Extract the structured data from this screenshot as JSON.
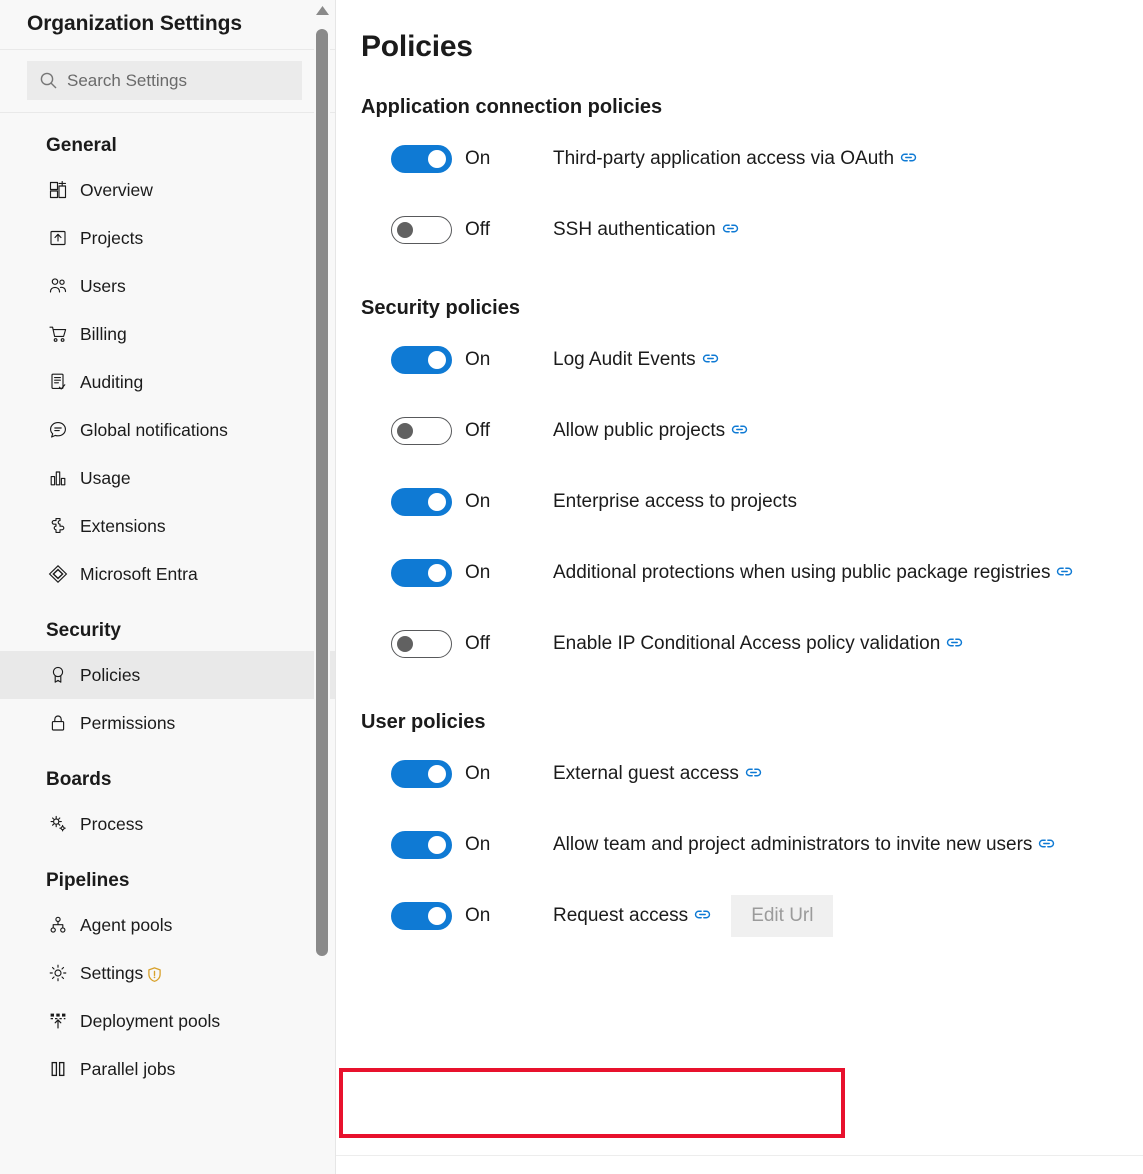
{
  "sidebar": {
    "title": "Organization Settings",
    "search": {
      "placeholder": "Search Settings",
      "value": "",
      "icon": "search-icon"
    },
    "groups": [
      {
        "title": "General",
        "items": [
          {
            "label": "Overview",
            "icon": "overview-icon",
            "selected": false
          },
          {
            "label": "Projects",
            "icon": "projects-icon",
            "selected": false
          },
          {
            "label": "Users",
            "icon": "users-icon",
            "selected": false
          },
          {
            "label": "Billing",
            "icon": "billing-cart-icon",
            "selected": false
          },
          {
            "label": "Auditing",
            "icon": "auditing-icon",
            "selected": false
          },
          {
            "label": "Global notifications",
            "icon": "notification-bubble-icon",
            "selected": false
          },
          {
            "label": "Usage",
            "icon": "usage-chart-icon",
            "selected": false
          },
          {
            "label": "Extensions",
            "icon": "extensions-puzzle-icon",
            "selected": false
          },
          {
            "label": "Microsoft Entra",
            "icon": "microsoft-entra-icon",
            "selected": false
          }
        ]
      },
      {
        "title": "Security",
        "items": [
          {
            "label": "Policies",
            "icon": "policies-ribbon-icon",
            "selected": true
          },
          {
            "label": "Permissions",
            "icon": "lock-icon",
            "selected": false
          }
        ]
      },
      {
        "title": "Boards",
        "items": [
          {
            "label": "Process",
            "icon": "process-gears-icon",
            "selected": false
          }
        ]
      },
      {
        "title": "Pipelines",
        "items": [
          {
            "label": "Agent pools",
            "icon": "agent-pools-icon",
            "selected": false
          },
          {
            "label": "Settings",
            "icon": "gear-icon",
            "selected": false,
            "badge": "warning-shield-icon"
          },
          {
            "label": "Deployment pools",
            "icon": "deployment-pools-icon",
            "selected": false
          },
          {
            "label": "Parallel jobs",
            "icon": "parallel-jobs-icon",
            "selected": false
          }
        ]
      }
    ],
    "scrollbar": {
      "up_arrow": "scroll-up-arrow-icon"
    }
  },
  "main": {
    "page_title": "Policies",
    "sections": [
      {
        "title": "Application connection policies",
        "policies": [
          {
            "state": "On",
            "on": true,
            "label": "Third-party application access via OAuth",
            "has_link": true,
            "button": null
          },
          {
            "state": "Off",
            "on": false,
            "label": "SSH authentication",
            "has_link": true,
            "button": null
          }
        ]
      },
      {
        "title": "Security policies",
        "policies": [
          {
            "state": "On",
            "on": true,
            "label": "Log Audit Events",
            "has_link": true,
            "button": null
          },
          {
            "state": "Off",
            "on": false,
            "label": "Allow public projects",
            "has_link": true,
            "button": null
          },
          {
            "state": "On",
            "on": true,
            "label": "Enterprise access to projects",
            "has_link": false,
            "button": null
          },
          {
            "state": "On",
            "on": true,
            "label": "Additional protections when using public package registries",
            "has_link": true,
            "button": null
          },
          {
            "state": "Off",
            "on": false,
            "label": "Enable IP Conditional Access policy validation",
            "has_link": true,
            "button": null
          }
        ]
      },
      {
        "title": "User policies",
        "policies": [
          {
            "state": "On",
            "on": true,
            "label": "External guest access",
            "has_link": true,
            "button": null
          },
          {
            "state": "On",
            "on": true,
            "label": "Allow team and project administrators to invite new users",
            "has_link": true,
            "button": null
          },
          {
            "state": "On",
            "on": true,
            "label": "Request access",
            "has_link": true,
            "button": "Edit Url",
            "highlighted": true
          }
        ]
      }
    ]
  },
  "colors": {
    "toggle_on": "#0f7ad4",
    "link_icon": "#0f7ad4",
    "highlight_border": "#e8112d",
    "sidebar_bg": "#f8f8f8",
    "selected_item_bg": "#e9e9e9",
    "warning_shield": "#d8a12a"
  }
}
